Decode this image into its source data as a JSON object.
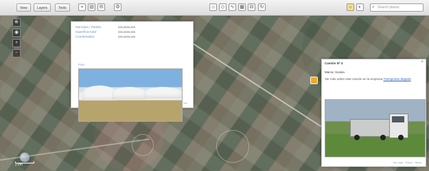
{
  "toolbar": {
    "buttons": [
      "View",
      "Layers",
      "Tools"
    ],
    "search_placeholder": "Search places"
  },
  "popup_left": {
    "rows": [
      {
        "label": "Municipio / Partido:",
        "value": "xxx,xxxx,xxx"
      },
      {
        "label": "Superficie total:",
        "value": "xxx,xxxx,xxx"
      },
      {
        "label": "Coordenadas:",
        "value": "xxx,xxxx,xxx"
      }
    ],
    "photo_label": "Foto",
    "footer": "Foto 1 | Ver"
  },
  "popup_right": {
    "title": "Camión Nº 4",
    "sub": "Marca: Scania",
    "description": "Ver más sobre este camión en la empresa ",
    "link": "Transportes Mapeta",
    "footer": "Ver más · Fotos · Otros"
  },
  "scale": {
    "label": "2 km"
  }
}
